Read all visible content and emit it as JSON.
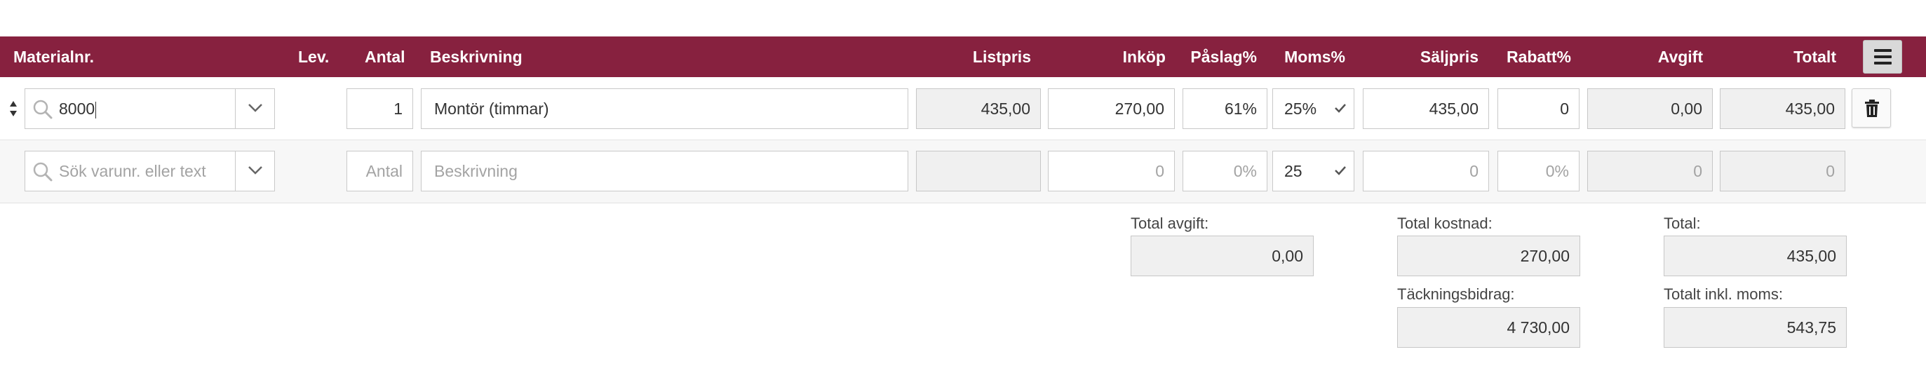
{
  "header": {
    "columns": {
      "materialnr": "Materialnr.",
      "lev": "Lev.",
      "antal": "Antal",
      "beskrivning": "Beskrivning",
      "listpris": "Listpris",
      "inkop": "Inköp",
      "paslag": "Påslag%",
      "moms": "Moms%",
      "saljpris": "Säljpris",
      "rabatt": "Rabatt%",
      "avgift": "Avgift",
      "totalt": "Totalt"
    },
    "menu_icon": "hamburger-menu-icon",
    "background_color": "#87213f"
  },
  "rows": [
    {
      "materialnr": "8000",
      "antal": "1",
      "beskrivning": "Montör (timmar)",
      "listpris": "435,00",
      "inkop": "270,00",
      "paslag": "61%",
      "moms": "25%",
      "saljpris": "435,00",
      "rabatt": "0",
      "avgift": "0,00",
      "totalt": "435,00",
      "icons": [
        "drag-handle-icon",
        "search-icon",
        "chevron-down-icon",
        "check-icon",
        "trash-icon"
      ]
    }
  ],
  "new_row": {
    "materialnr_placeholder": "Sök varunr. eller text",
    "antal_placeholder": "Antal",
    "beskrivning_placeholder": "Beskrivning",
    "listpris": "",
    "inkop_placeholder": "0",
    "paslag_placeholder": "0%",
    "moms": "25",
    "saljpris_placeholder": "0",
    "rabatt_placeholder": "0%",
    "avgift": "0",
    "totalt": "0"
  },
  "totals": {
    "total_avgift_label": "Total avgift:",
    "total_avgift": "0,00",
    "total_kostnad_label": "Total kostnad:",
    "total_kostnad": "270,00",
    "tackningsbidrag_label": "Täckningsbidrag:",
    "tackningsbidrag": "4 730,00",
    "total_label": "Total:",
    "total": "435,00",
    "totalt_inkl_moms_label": "Totalt inkl. moms:",
    "totalt_inkl_moms": "543,75"
  }
}
